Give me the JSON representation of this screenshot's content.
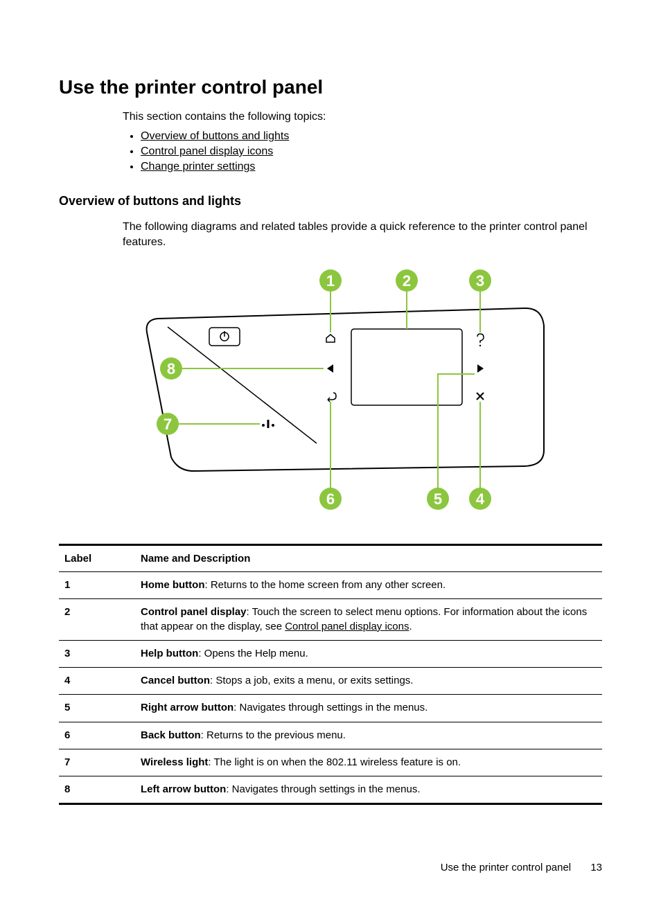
{
  "heading": "Use the printer control panel",
  "intro": "This section contains the following topics:",
  "topics": [
    "Overview of buttons and lights",
    "Control panel display icons",
    "Change printer settings"
  ],
  "subheading": "Overview of buttons and lights",
  "subsection_text": "The following diagrams and related tables provide a quick reference to the printer control panel features.",
  "diagram": {
    "callouts": [
      "1",
      "2",
      "3",
      "4",
      "5",
      "6",
      "7",
      "8"
    ],
    "callout_color": "#8CC63F"
  },
  "table": {
    "headers": [
      "Label",
      "Name and Description"
    ],
    "rows": [
      {
        "label": "1",
        "name": "Home button",
        "desc": ": Returns to the home screen from any other screen."
      },
      {
        "label": "2",
        "name": "Control panel display",
        "desc": ": Touch the screen to select menu options. For information about the icons that appear on the display, see ",
        "link": "Control panel display icons",
        "desc_after": "."
      },
      {
        "label": "3",
        "name": "Help button",
        "desc": ": Opens the Help menu."
      },
      {
        "label": "4",
        "name": "Cancel button",
        "desc": ": Stops a job, exits a menu, or exits settings."
      },
      {
        "label": "5",
        "name": "Right arrow button",
        "desc": ": Navigates through settings in the menus."
      },
      {
        "label": "6",
        "name": "Back button",
        "desc": ": Returns to the previous menu."
      },
      {
        "label": "7",
        "name": "Wireless light",
        "desc": ": The light is on when the 802.11 wireless feature is on."
      },
      {
        "label": "8",
        "name": "Left arrow button",
        "desc": ": Navigates through settings in the menus."
      }
    ]
  },
  "footer": {
    "section": "Use the printer control panel",
    "page": "13"
  }
}
